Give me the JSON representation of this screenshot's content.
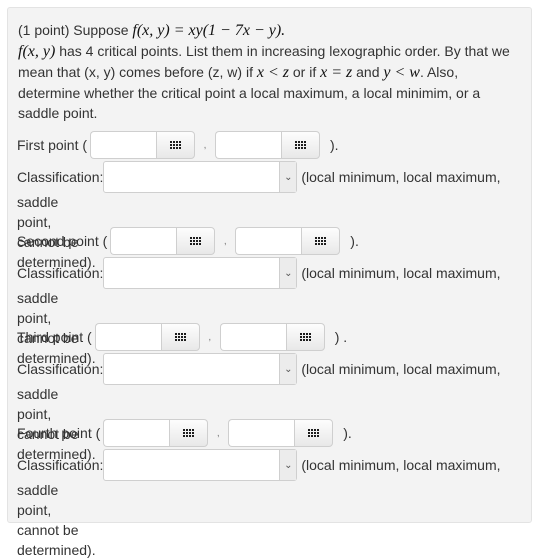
{
  "intro": {
    "prefix": "(1 point) Suppose ",
    "function_def": "f(x, y) = xy(1 − 7x − y).",
    "line2_func": "f(x, y)",
    "line2_text": " has 4 critical points. List them in increasing lexographic order. By that we mean that (x, y) comes before (z, w) if ",
    "cond1": "x < z",
    "or_if": " or if ",
    "cond2": "x = z",
    "and": " and ",
    "cond3": "y < w",
    "tail": ". Also, determine whether the critical point a local maximum, a local minimim, or a saddle point."
  },
  "points": [
    {
      "label": "First point (",
      "x_value": "",
      "y_value": "",
      "comma": ",",
      "close": ").",
      "classification_label": "Classification:",
      "selected": "",
      "options_hint": "(local minimum, local maximum,",
      "options_hint2": "saddle point, cannot be determined)."
    },
    {
      "label": "Second point (",
      "x_value": "",
      "y_value": "",
      "comma": ",",
      "close": ").",
      "classification_label": "Classification:",
      "selected": "",
      "options_hint": "(local minimum, local maximum,",
      "options_hint2": "saddle point, cannot be determined)."
    },
    {
      "label": "Third point (",
      "x_value": "",
      "y_value": "",
      "comma": ",",
      "close": ") .",
      "classification_label": "Classification:",
      "selected": "",
      "options_hint": "(local minimum, local maximum,",
      "options_hint2": "saddle point, cannot be determined)."
    },
    {
      "label": "Fourth point (",
      "x_value": "",
      "y_value": "",
      "comma": ",",
      "close": ").",
      "classification_label": "Classification:",
      "selected": "",
      "options_hint": "(local minimum, local maximum,",
      "options_hint2": "saddle point, cannot be determined)."
    }
  ],
  "icons": {
    "equation_button": "grid-keypad-icon",
    "select_arrow": "chevron-down-icon"
  }
}
